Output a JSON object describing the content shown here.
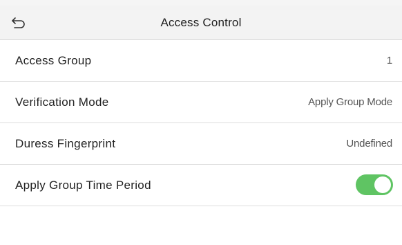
{
  "header": {
    "title": "Access Control",
    "back_icon": "back-arrow-icon"
  },
  "rows": [
    {
      "label": "Access Group",
      "value": "1"
    },
    {
      "label": "Verification Mode",
      "value": "Apply Group Mode"
    },
    {
      "label": "Duress Fingerprint",
      "value": "Undefined"
    },
    {
      "label": "Apply Group Time Period",
      "toggle": true
    }
  ],
  "colors": {
    "toggle_on": "#5fc463",
    "header_bg": "#f3f3f3",
    "divider": "#dcdcdc"
  }
}
